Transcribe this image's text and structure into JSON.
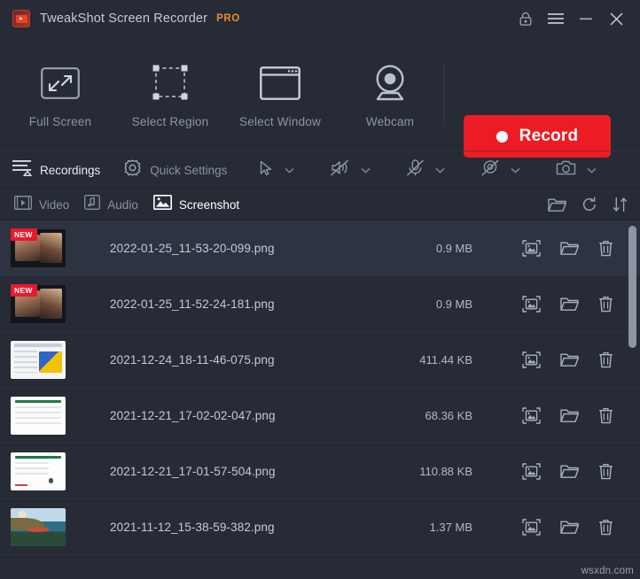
{
  "window": {
    "title": "TweakShot Screen Recorder",
    "pro_badge": "PRO",
    "logo_icon": "tweakshot-logo-icon",
    "controls": [
      {
        "name": "store-lock-icon",
        "label": "Store"
      },
      {
        "name": "hamburger-menu-icon",
        "label": "Menu"
      },
      {
        "name": "minimize-icon",
        "label": "Minimize"
      },
      {
        "name": "close-icon",
        "label": "Close"
      }
    ]
  },
  "capture_modes": [
    {
      "label": "Full Screen",
      "icon": "full-screen-icon"
    },
    {
      "label": "Select Region",
      "icon": "select-region-icon"
    },
    {
      "label": "Select Window",
      "icon": "select-window-icon"
    },
    {
      "label": "Webcam",
      "icon": "webcam-icon"
    }
  ],
  "record": {
    "label": "Record",
    "icon": "record-dot-icon",
    "color": "#ed1c24"
  },
  "subbar": {
    "recordings": {
      "label": "Recordings",
      "icon": "recordings-icon",
      "active": true
    },
    "quick_settings": {
      "label": "Quick Settings",
      "icon": "gear-icon",
      "active": false
    },
    "tools": [
      {
        "name": "cursor-icon",
        "state": "on"
      },
      {
        "name": "system-audio-muted-icon",
        "state": "muted"
      },
      {
        "name": "microphone-muted-icon",
        "state": "muted"
      },
      {
        "name": "webcam-off-icon",
        "state": "off"
      },
      {
        "name": "camera-icon",
        "state": "on"
      }
    ]
  },
  "tabs": [
    {
      "label": "Video",
      "icon": "video-icon",
      "active": false
    },
    {
      "label": "Audio",
      "icon": "audio-note-icon",
      "active": false
    },
    {
      "label": "Screenshot",
      "icon": "screenshot-image-icon",
      "active": true
    }
  ],
  "tabrow_actions": [
    {
      "name": "open-folder-icon",
      "label": "Open Folder"
    },
    {
      "name": "refresh-icon",
      "label": "Refresh"
    },
    {
      "name": "sort-icon",
      "label": "Sort"
    }
  ],
  "list": {
    "row_actions": [
      {
        "name": "preview-image-icon",
        "label": "Preview"
      },
      {
        "name": "open-location-folder-icon",
        "label": "Open Location"
      },
      {
        "name": "delete-trash-icon",
        "label": "Delete"
      }
    ],
    "new_badge_label": "NEW",
    "rows": [
      {
        "filename": "2022-01-25_11-53-20-099.png",
        "size": "0.9 MB",
        "is_new": true,
        "selected": true,
        "thumb": "tb-video"
      },
      {
        "filename": "2022-01-25_11-52-24-181.png",
        "size": "0.9 MB",
        "is_new": true,
        "selected": false,
        "thumb": "tb-video"
      },
      {
        "filename": "2021-12-24_18-11-46-075.png",
        "size": "411.44 KB",
        "is_new": false,
        "selected": false,
        "thumb": "tb-doc"
      },
      {
        "filename": "2021-12-21_17-02-02-047.png",
        "size": "68.36 KB",
        "is_new": false,
        "selected": false,
        "thumb": "tb-web"
      },
      {
        "filename": "2021-12-21_17-01-57-504.png",
        "size": "110.88 KB",
        "is_new": false,
        "selected": false,
        "thumb": "tb-web2"
      },
      {
        "filename": "2021-11-12_15-38-59-382.png",
        "size": "1.37 MB",
        "is_new": false,
        "selected": false,
        "thumb": "tb-scene"
      }
    ]
  },
  "watermark": "wsxdn.com"
}
